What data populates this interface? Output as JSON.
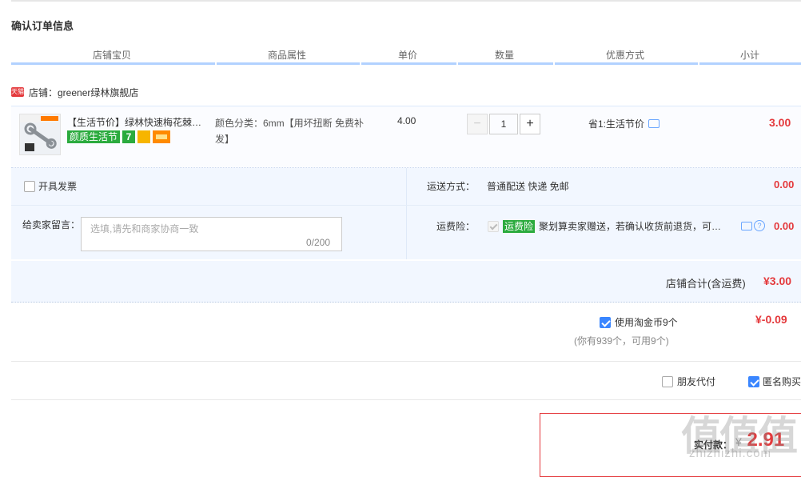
{
  "page": {
    "title": "确认订单信息"
  },
  "table_header": {
    "shop_item": "店铺宝贝",
    "attributes": "商品属性",
    "unit_price": "单价",
    "quantity": "数量",
    "discount": "优惠方式",
    "subtotal": "小计"
  },
  "shop": {
    "badge": "天猫",
    "name": "店铺：greener绿林旗舰店"
  },
  "item": {
    "name": "【生活节价】绿林快速梅花棘轮扳手",
    "badge_festival": "颜质生活节",
    "badge_seven": "7",
    "attributes": "颜色分类：6mm【用坏扭断 免费补发】",
    "unit_price": "4.00",
    "quantity": "1",
    "qty_minus": "−",
    "qty_plus": "+",
    "promo": "省1:生活节价",
    "subtotal": "3.00"
  },
  "invoice": {
    "label": "开具发票"
  },
  "shipping": {
    "label": "运送方式：",
    "value": "普通配送 快递 免邮",
    "fee": "0.00"
  },
  "message": {
    "label": "给卖家留言：",
    "placeholder": "选填,请先和商家协商一致",
    "count": "0/200"
  },
  "insurance": {
    "label": "运费险：",
    "badge": "运费险",
    "text": "聚划算卖家赠送，若确认收货前退货，可获保险赔付",
    "fee": "0.00"
  },
  "shop_total": {
    "label": "店铺合计(含运费)",
    "value": "¥3.00"
  },
  "coins": {
    "label": "使用淘金币9个",
    "value": "¥-0.09",
    "sub": "(你有939个，可用9个)"
  },
  "options": {
    "friend_pay": "朋友代付",
    "anonymous": "匿名购买"
  },
  "final": {
    "label": "实付款：",
    "currency": "¥",
    "value": "2.91"
  },
  "watermark": {
    "main": "值值值",
    "sub": "zhizhizhi.com"
  },
  "colors": {
    "accent": "#e4393c",
    "header_line": "#b2d1ff",
    "panel_bg": "#f2f7ff",
    "green_badge": "#2bab3e",
    "check_blue": "#3a86ff"
  }
}
